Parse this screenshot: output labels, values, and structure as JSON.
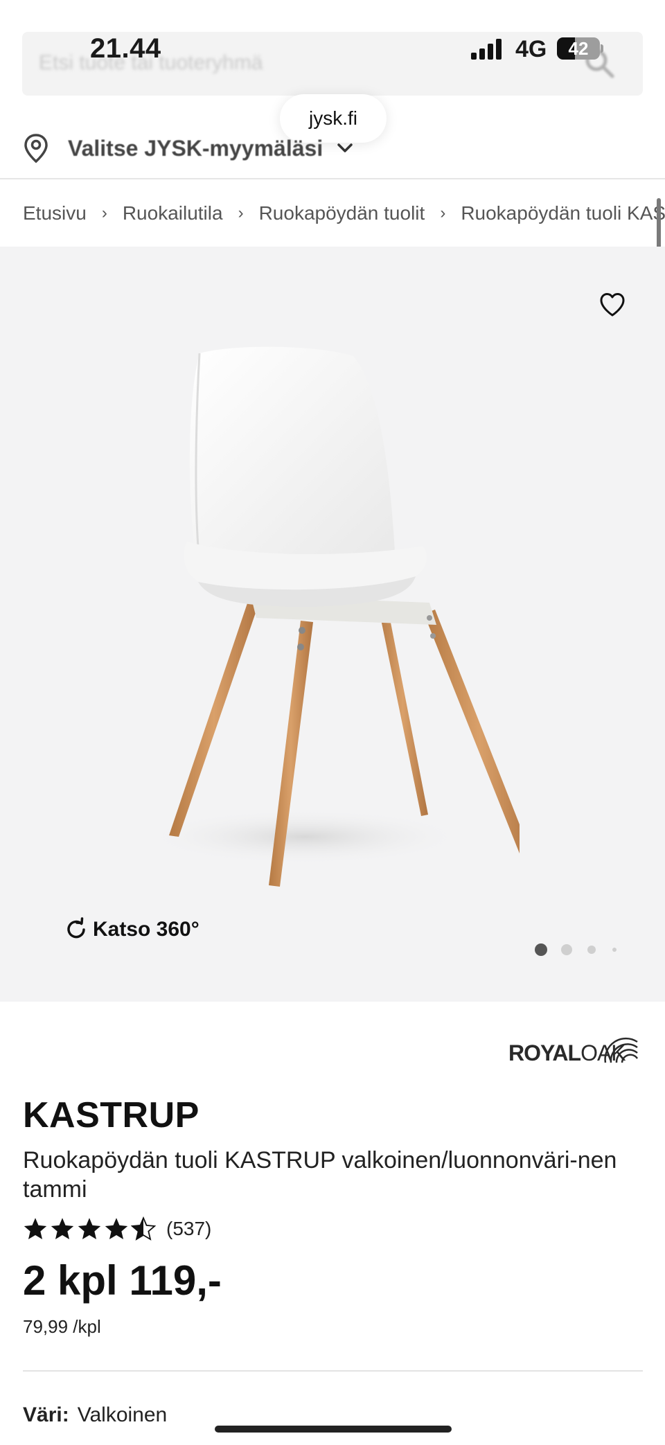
{
  "status_bar": {
    "time": "21.44",
    "network": "4G",
    "battery_level": "42",
    "battery_fraction": 0.42
  },
  "search": {
    "placeholder": "Etsi tuote tai tuoteryhmä"
  },
  "browser": {
    "url": "jysk.fi"
  },
  "store_selector": {
    "label": "Valitse JYSK-myymäläsi"
  },
  "breadcrumb": {
    "items": [
      "Etusivu",
      "Ruokailutila",
      "Ruokapöydän tuolit",
      "Ruokapöydän tuoli KAS"
    ],
    "separator": "›"
  },
  "gallery": {
    "view360_label": "Katso 360°",
    "image_count": 4,
    "active_index": 0
  },
  "product": {
    "brand_bold": "ROYAL",
    "brand_light": "OAK",
    "name": "KASTRUP",
    "description": "Ruokapöydän tuoli KASTRUP valkoinen/luonnonväri-nen tammi",
    "rating_stars": 4.5,
    "review_count": "(537)",
    "price": "2 kpl 119,-",
    "unit_price": "79,99 /kpl",
    "color_label": "Väri:",
    "color_value": "Valkoinen"
  },
  "colors": {
    "gallery_bg": "#f3f3f4",
    "text": "#1a1a1a",
    "wood": "#c98a50"
  }
}
